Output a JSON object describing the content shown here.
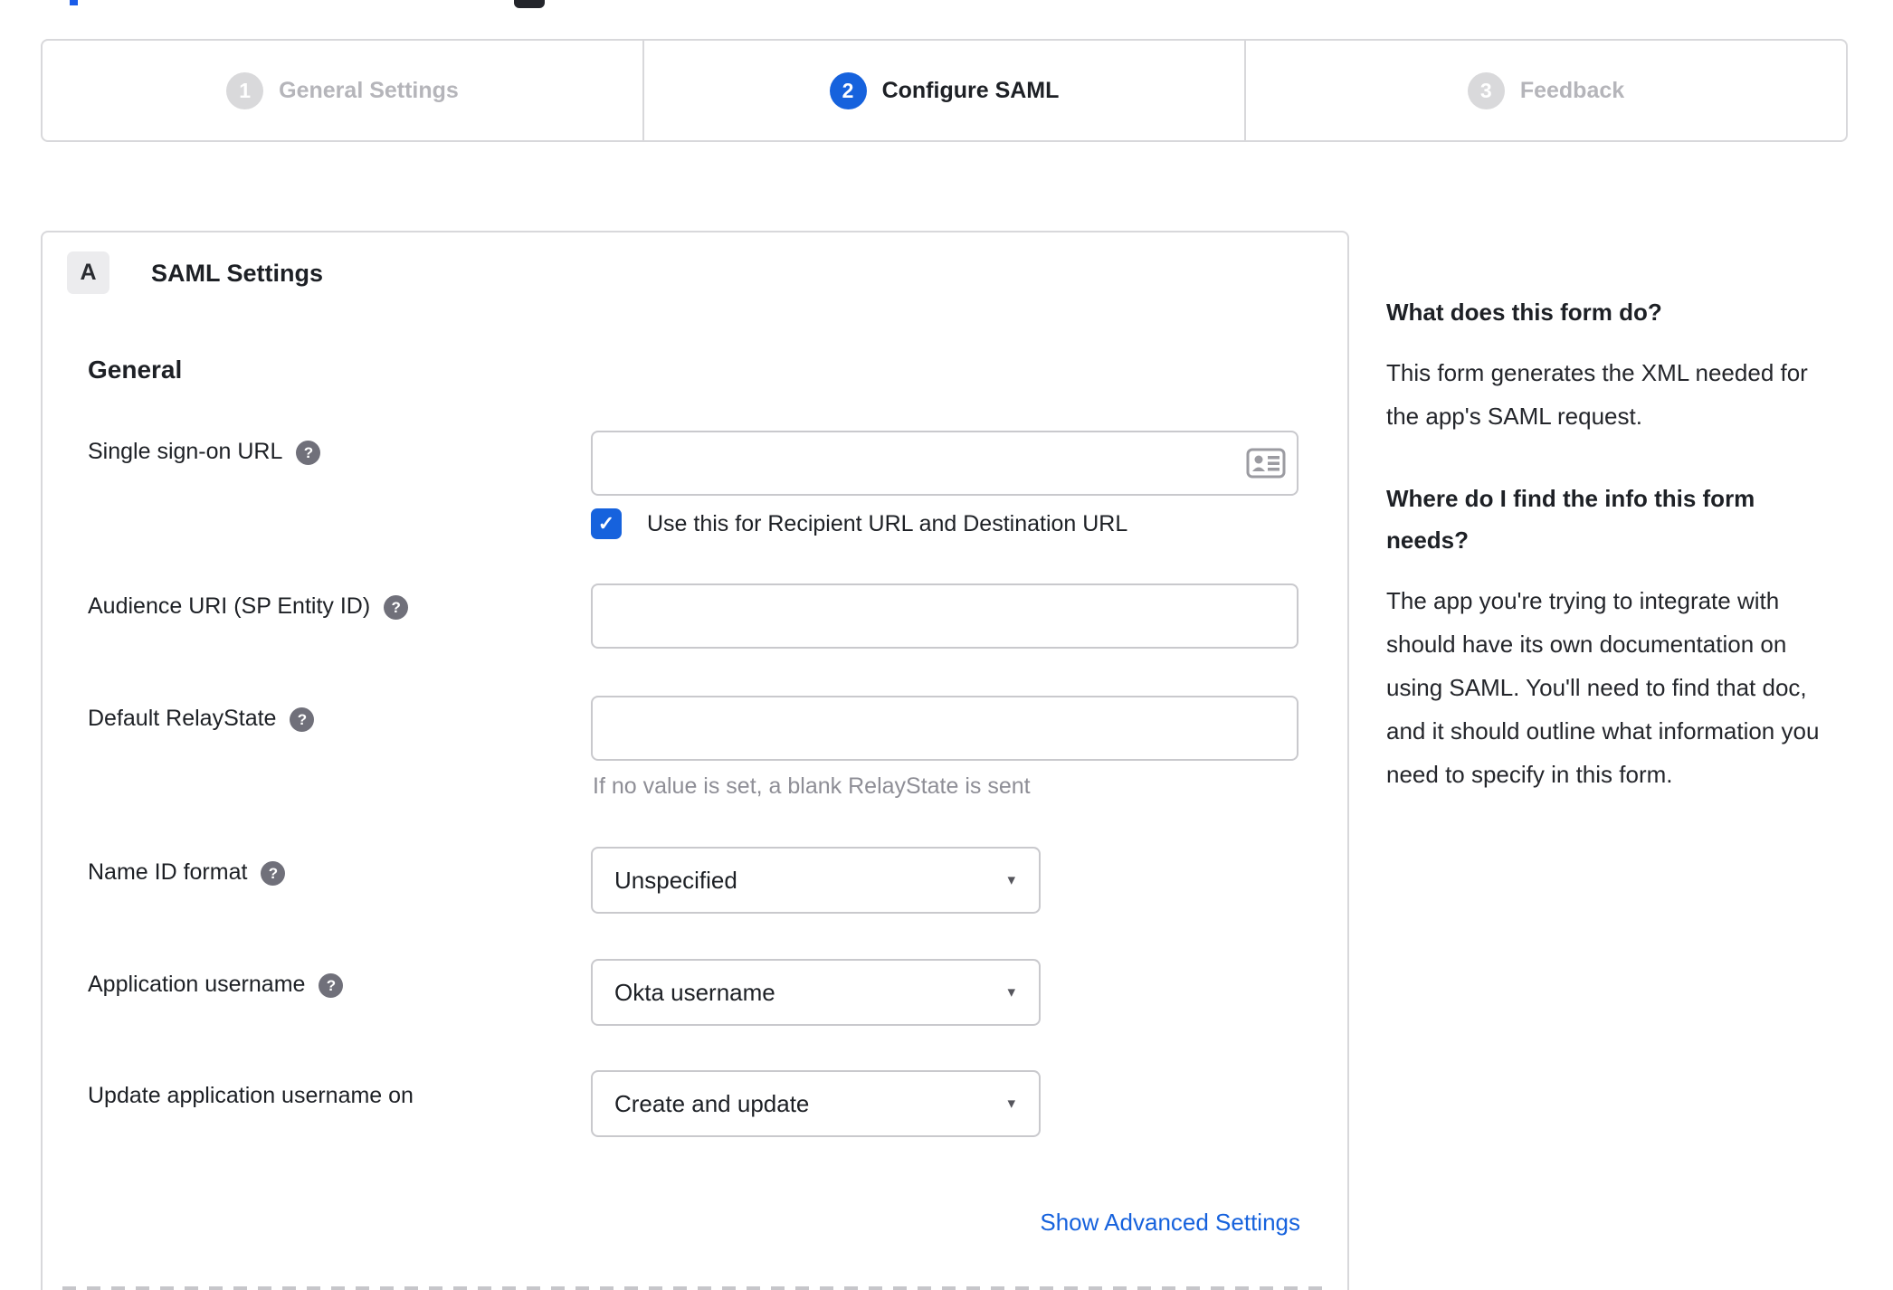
{
  "colors": {
    "accent_blue": "#1662dd",
    "dark_text": "#1d2025",
    "muted_text": "#b5b5ba",
    "hint_text": "#8e8e96",
    "border": "#d8d8db",
    "input_border": "#c9c9cd",
    "help_icon_bg": "#70707a",
    "badge_bg": "#ececee"
  },
  "stepper": {
    "steps": [
      {
        "number": "1",
        "label": "General Settings",
        "state": "inactive"
      },
      {
        "number": "2",
        "label": "Configure SAML",
        "state": "active"
      },
      {
        "number": "3",
        "label": "Feedback",
        "state": "inactive"
      }
    ]
  },
  "panel": {
    "badge": "A",
    "title": "SAML Settings",
    "section_heading": "General",
    "fields": {
      "sso_url": {
        "label": "Single sign-on URL",
        "value": ""
      },
      "sso_checkbox": {
        "label": "Use this for Recipient URL and Destination URL",
        "checked": true
      },
      "audience_uri": {
        "label": "Audience URI (SP Entity ID)",
        "value": ""
      },
      "default_relaystate": {
        "label": "Default RelayState",
        "value": "",
        "hint": "If no value is set, a blank RelayState is sent"
      },
      "name_id_format": {
        "label": "Name ID format",
        "value": "Unspecified"
      },
      "application_username": {
        "label": "Application username",
        "value": "Okta username"
      },
      "update_app_username": {
        "label": "Update application username on",
        "value": "Create and update"
      }
    },
    "advanced_link": "Show Advanced Settings"
  },
  "sidebar": {
    "q1_title": "What does this form do?",
    "q1_body": "This form generates the XML needed for the app's SAML request.",
    "q2_title": "Where do I find the info this form needs?",
    "q2_body": "The app you're trying to integrate with should have its own documentation on using SAML. You'll need to find that doc, and it should outline what information you need to specify in this form."
  },
  "icons": {
    "help": "?",
    "check": "✓",
    "dropdown_arrow": "▾"
  }
}
